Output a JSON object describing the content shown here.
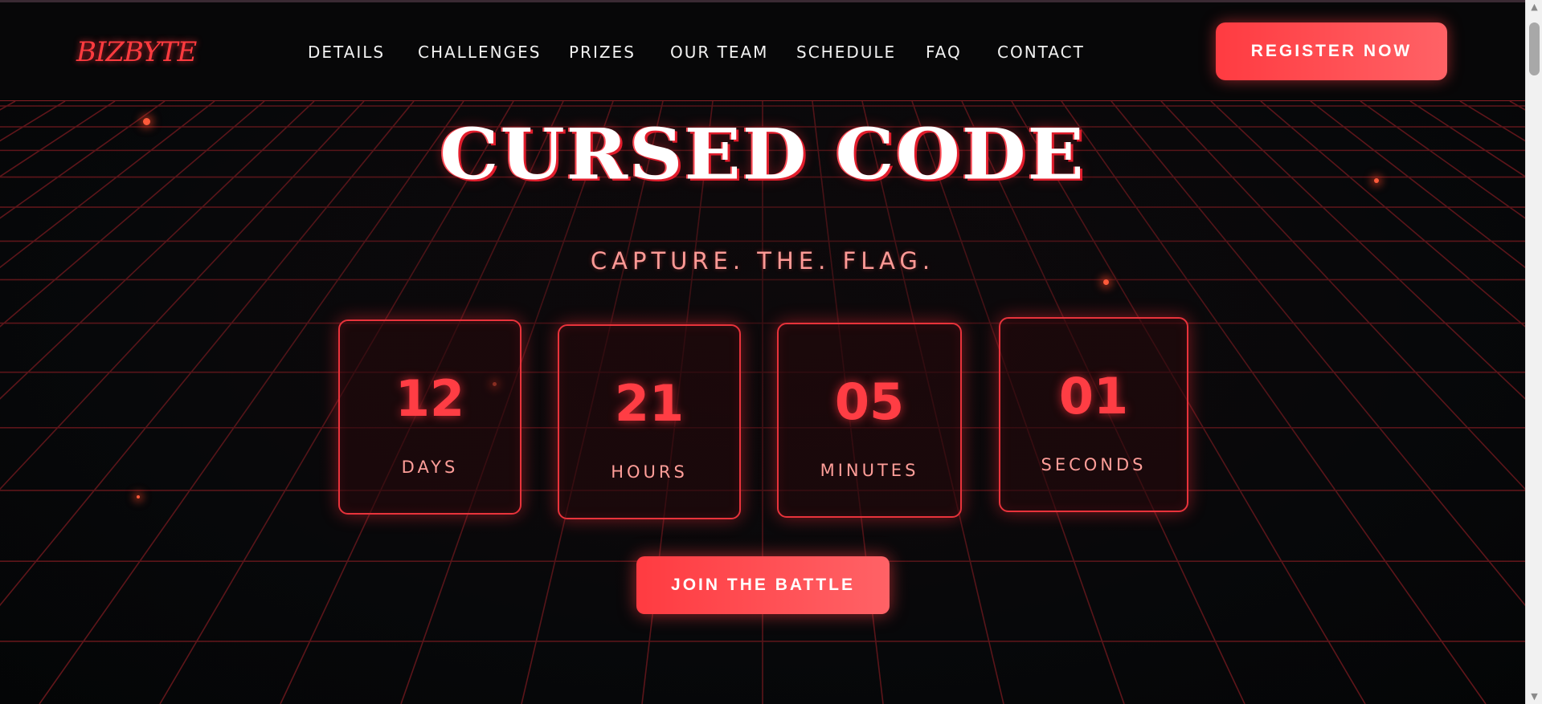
{
  "brand": {
    "logo_text": "BIZBYTE",
    "accent_color": "#ff3b41"
  },
  "nav": {
    "items": [
      {
        "label": "DETAILS"
      },
      {
        "label": "CHALLENGES"
      },
      {
        "label": "PRIZES"
      },
      {
        "label": "OUR TEAM"
      },
      {
        "label": "SCHEDULE"
      },
      {
        "label": "FAQ"
      },
      {
        "label": "CONTACT"
      }
    ],
    "register_label": "REGISTER NOW"
  },
  "hero": {
    "title": "CURSED CODE",
    "subtitle": "CAPTURE. THE. FLAG.",
    "countdown": [
      {
        "value": "12",
        "label": "DAYS"
      },
      {
        "value": "21",
        "label": "HOURS"
      },
      {
        "value": "05",
        "label": "MINUTES"
      },
      {
        "value": "01",
        "label": "SECONDS"
      }
    ],
    "cta_label": "JOIN THE BATTLE"
  },
  "scrollbar": {
    "up_icon": "triangle-up",
    "down_icon": "triangle-down"
  }
}
